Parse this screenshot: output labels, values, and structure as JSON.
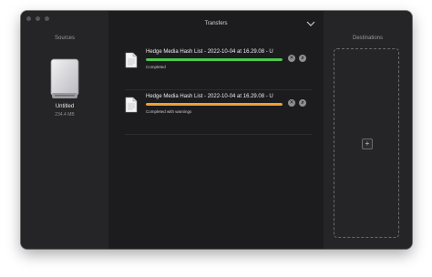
{
  "sources": {
    "title": "Sources",
    "drive": {
      "name": "Untitled",
      "size": "234.4 MB",
      "icon": "external-drive-icon"
    }
  },
  "transfers": {
    "title": "Transfers",
    "items": [
      {
        "name": "Hedge Media Hash List - 2022-10-04 at 16.29.08 - U",
        "status": "Completed",
        "progress_color": "#4cc94c",
        "progress": 1.0,
        "icon": "document-icon"
      },
      {
        "name": "Hedge Media Hash List - 2022-10-04 at 16.29.08 - U",
        "status": "Completed with warnings",
        "progress_color": "#f0a030",
        "progress": 1.0,
        "icon": "document-icon"
      }
    ]
  },
  "destinations": {
    "title": "Destinations",
    "add_label": "+"
  },
  "controls": {
    "close_glyph": "✕",
    "reveal_glyph": "⌕"
  }
}
